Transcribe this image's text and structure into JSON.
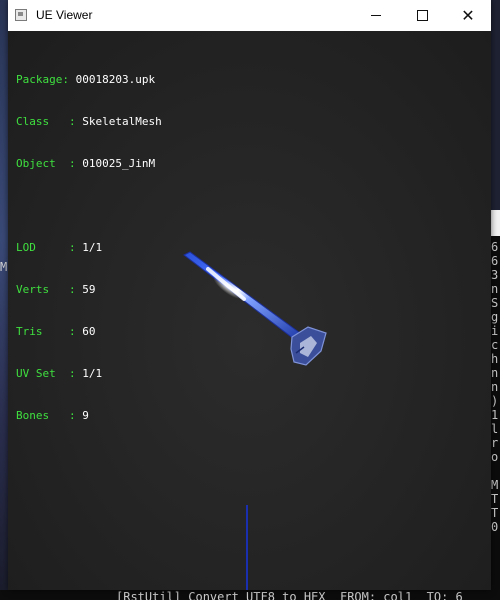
{
  "window": {
    "title": "UE Viewer",
    "controls": {
      "minimize": "—",
      "maximize": "□",
      "close": "✕"
    }
  },
  "info": {
    "package_label": "Package",
    "package": "00018203.upk",
    "class_label": "Class",
    "class": "SkeletalMesh",
    "object_label": "Object",
    "object": "010025_JinM",
    "lod_label": "LOD",
    "lod": "1/1",
    "verts_label": "Verts",
    "verts": "59",
    "tris_label": "Tris",
    "tris": "60",
    "uvset_label": "UV Set",
    "uvset": "1/1",
    "bones_label": "Bones",
    "bones": "9"
  },
  "background": {
    "left_char": "M",
    "console_column": "6\n6\n3\nn\nS\ng\ni\nc\nh\nn\nn\n)\n1\nl\nr\no\n\nM\nT\nT\n0",
    "console_bottom": "[RstUtil] Convert UTF8 to HEX  FROM: col1  TO: 6"
  },
  "colors": {
    "label_green": "#3fe03f",
    "value_white": "#ffffff",
    "blade_blue": "#2a4fd8",
    "axis_blue": "#1a2fb0"
  },
  "icons": {
    "app": "app-window-icon"
  }
}
